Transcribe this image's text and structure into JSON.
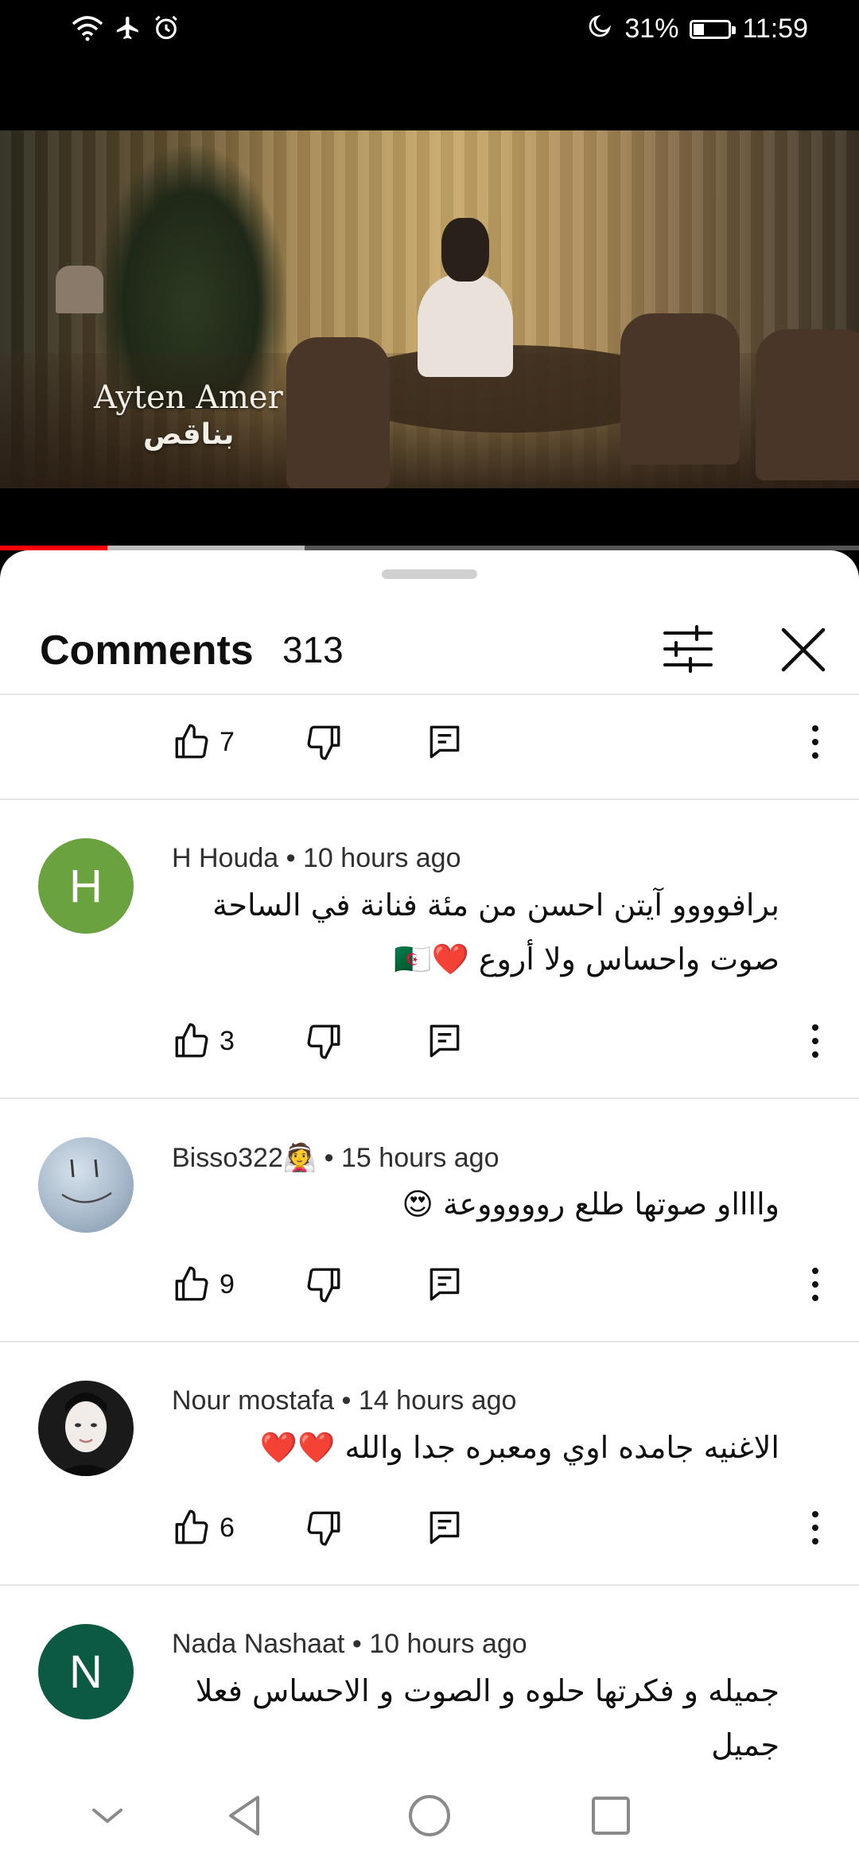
{
  "status_bar": {
    "battery_percent": "31%",
    "battery_level": 0.31,
    "time": "11:59",
    "icons": [
      "wifi-icon",
      "airplane-icon",
      "alarm-icon",
      "moon-icon",
      "battery-icon"
    ]
  },
  "video": {
    "overlay_title": "Ayten Amer",
    "overlay_subtitle": "بناقص",
    "progress_played": 0.125,
    "progress_buffered": 0.355,
    "colors": {
      "played": "#ff0000",
      "buffered": "#bdbdbd",
      "track": "#555555"
    }
  },
  "comments_panel": {
    "title": "Comments",
    "count": "313",
    "icons": [
      "filter-icon",
      "close-icon"
    ]
  },
  "top_partial_actions": {
    "likes": "7"
  },
  "comments": [
    {
      "author": "H Houda",
      "time": "10 hours ago",
      "avatar_letter": "H",
      "avatar_color": "#6aa23f",
      "lines": [
        "برافوووو آيتن احسن من مئة فنانة في الساحة",
        "صوت واحساس ولا أروع ❤️🇩🇿"
      ],
      "likes": "3"
    },
    {
      "author": "Bisso322👰",
      "time": "15 hours ago",
      "avatar_letter": "",
      "lines": [
        "وااااو صوتها طلع روووووعة 😍"
      ],
      "likes": "9"
    },
    {
      "author": "Nour mostafa",
      "time": "14 hours ago",
      "avatar_letter": "",
      "lines": [
        "الاغنيه جامده اوي ومعبره جدا والله ❤️❤️"
      ],
      "likes": "6"
    },
    {
      "author": "Nada Nashaat",
      "time": "10 hours ago",
      "avatar_letter": "N",
      "avatar_color": "#0d5a44",
      "lines": [
        "جميله و فكرتها حلوه و الصوت و الاحساس فعلا جميل",
        "😊❤️"
      ]
    }
  ],
  "separator": "•",
  "nav_bar": {
    "icons": [
      "collapse-icon",
      "back-icon",
      "home-icon",
      "recents-icon"
    ]
  }
}
